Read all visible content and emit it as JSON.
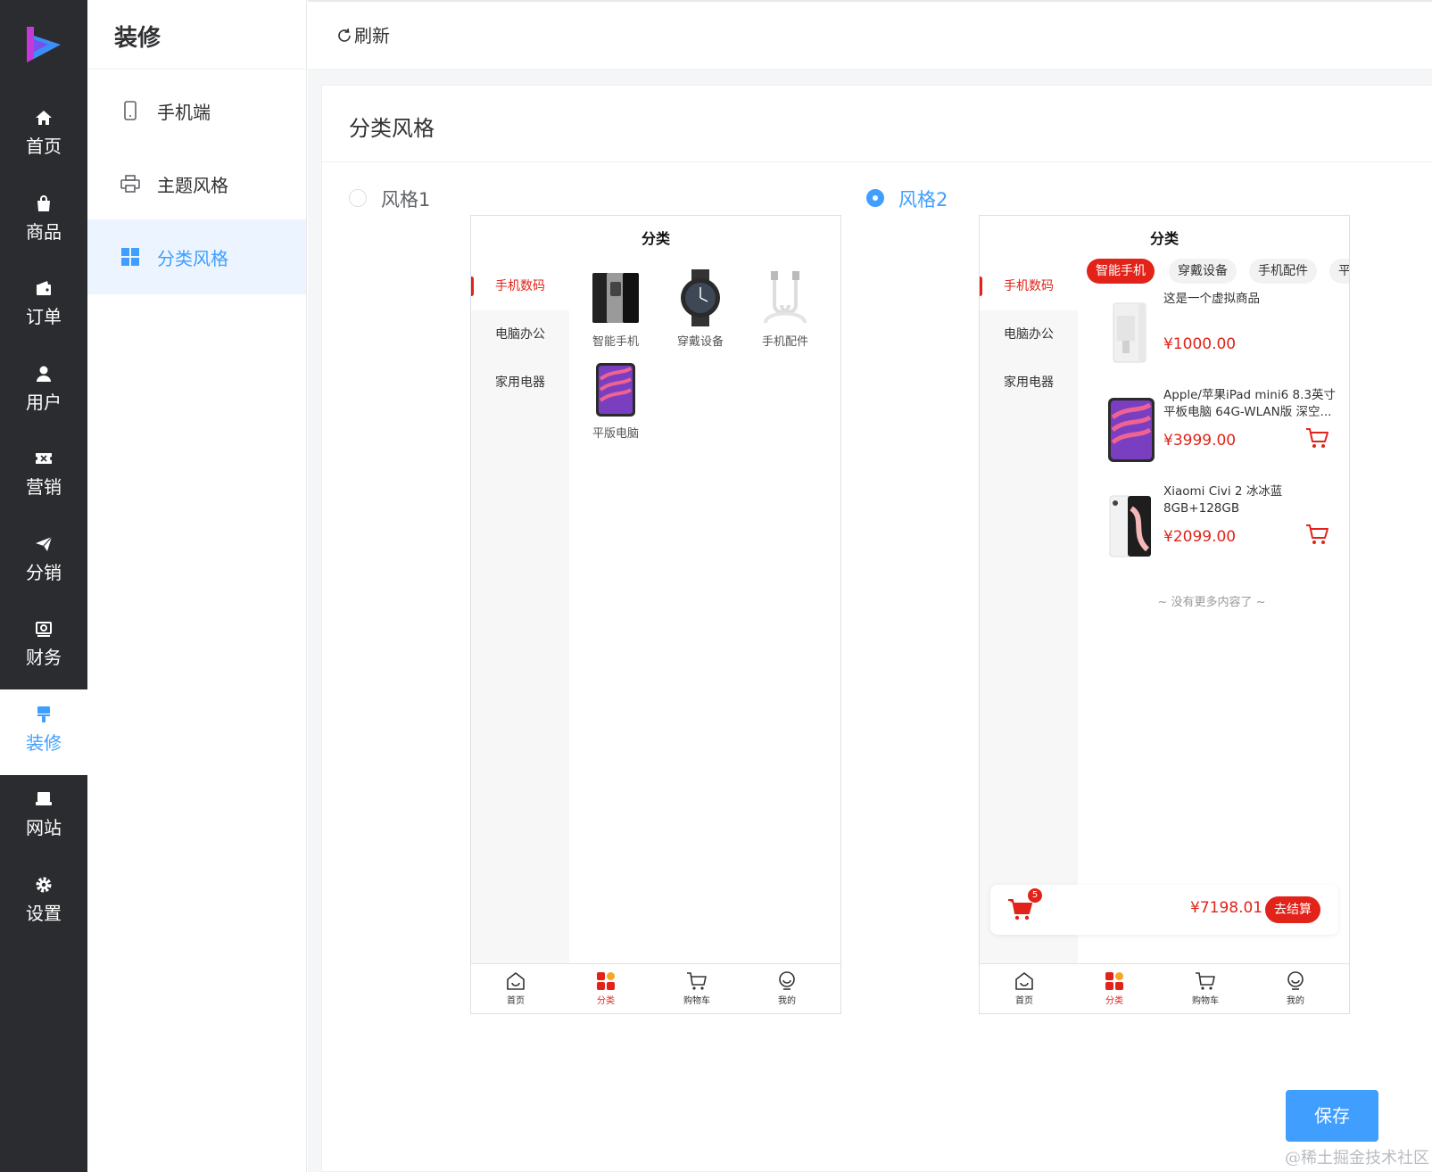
{
  "rail": {
    "items": [
      {
        "label": "首页",
        "icon": "home-icon"
      },
      {
        "label": "商品",
        "icon": "bag-icon"
      },
      {
        "label": "订单",
        "icon": "wallet-icon"
      },
      {
        "label": "用户",
        "icon": "user-icon"
      },
      {
        "label": "营销",
        "icon": "ticket-icon"
      },
      {
        "label": "分销",
        "icon": "send-icon"
      },
      {
        "label": "财务",
        "icon": "finance-icon"
      },
      {
        "label": "装修",
        "icon": "brush-icon",
        "active": true
      },
      {
        "label": "网站",
        "icon": "monitor-icon"
      },
      {
        "label": "设置",
        "icon": "gear-icon"
      }
    ]
  },
  "sub": {
    "title": "装修",
    "items": [
      {
        "label": "手机端",
        "icon": "mobile-icon"
      },
      {
        "label": "主题风格",
        "icon": "printer-icon"
      },
      {
        "label": "分类风格",
        "icon": "grid-icon",
        "active": true
      }
    ]
  },
  "topbar": {
    "refresh": "刷新"
  },
  "card": {
    "title": "分类风格",
    "style1": "风格1",
    "style2": "风格2",
    "selected": "风格2"
  },
  "phone1": {
    "title": "分类",
    "categories": [
      "手机数码",
      "电脑办公",
      "家用电器"
    ],
    "grid": [
      "智能手机",
      "穿戴设备",
      "手机配件",
      "平版电脑"
    ]
  },
  "phone2": {
    "title": "分类",
    "categories": [
      "手机数码",
      "电脑办公",
      "家用电器"
    ],
    "chips": [
      "智能手机",
      "穿戴设备",
      "手机配件",
      "平"
    ],
    "products": [
      {
        "name": "这是一个虚拟商品",
        "price": "¥1000.00"
      },
      {
        "name": "Apple/苹果iPad mini6 8.3英寸平板电脑 64G-WLAN版 深空...",
        "price": "¥3999.00"
      },
      {
        "name": "Xiaomi Civi 2 冰冰蓝 8GB+128GB",
        "price": "¥2099.00"
      }
    ],
    "no_more": "~ 没有更多内容了 ~",
    "cart_count": "5",
    "total": "¥7198.01",
    "checkout": "去结算"
  },
  "tabbar": [
    "首页",
    "分类",
    "购物车",
    "我的"
  ],
  "save": "保存",
  "watermark": "@稀土掘金技术社区",
  "colors": {
    "primary": "#409eff",
    "accent_red": "#e2231a",
    "rail_bg": "#2b2c2f"
  }
}
